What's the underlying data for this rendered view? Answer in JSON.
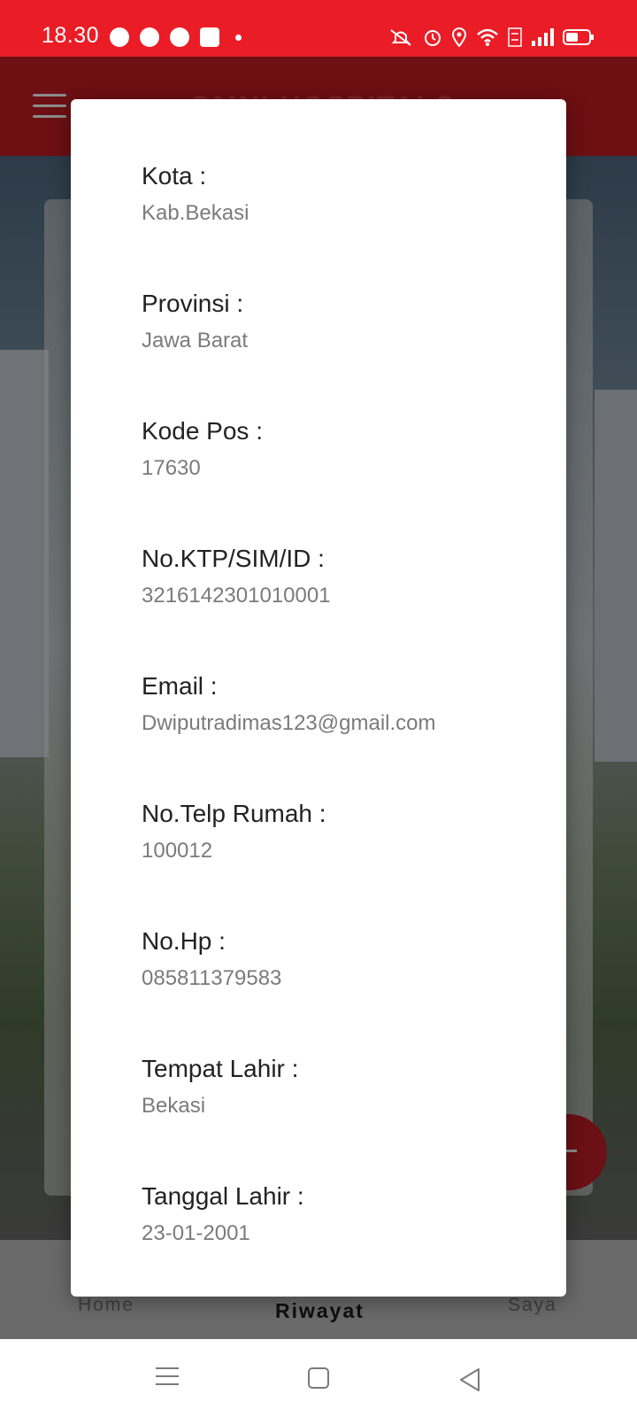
{
  "status_bar": {
    "time": "18.30",
    "app_icons": [
      "line-icon",
      "discord-icon",
      "chat-bubble-icon",
      "facebook-icon"
    ],
    "system_icons": [
      "mute-icon",
      "alarm-icon",
      "location-icon",
      "wifi-icon",
      "volte-icon",
      "signal-icon",
      "battery-icon"
    ]
  },
  "app_bar": {
    "title": "OMNI HOSPITALS"
  },
  "bottom_nav": {
    "items": [
      {
        "label": "Home"
      },
      {
        "label": "Riwayat"
      },
      {
        "label": "Saya"
      }
    ]
  },
  "dialog": {
    "fields": [
      {
        "label": "Kota :",
        "value": "Kab.Bekasi"
      },
      {
        "label": "Provinsi :",
        "value": "Jawa Barat"
      },
      {
        "label": "Kode Pos :",
        "value": "17630"
      },
      {
        "label": "No.KTP/SIM/ID :",
        "value": "3216142301010001"
      },
      {
        "label": "Email :",
        "value": "Dwiputradimas123@gmail.com"
      },
      {
        "label": "No.Telp Rumah :",
        "value": "100012"
      },
      {
        "label": "No.Hp :",
        "value": "085811379583"
      },
      {
        "label": "Tempat Lahir :",
        "value": "Bekasi"
      },
      {
        "label": "Tanggal Lahir :",
        "value": "23-01-2001"
      }
    ]
  },
  "colors": {
    "status_bar": "#ea1d27",
    "app_bar_dimmed": "#6d0f13",
    "label_text": "#222222",
    "value_text": "#7b7b7b"
  }
}
